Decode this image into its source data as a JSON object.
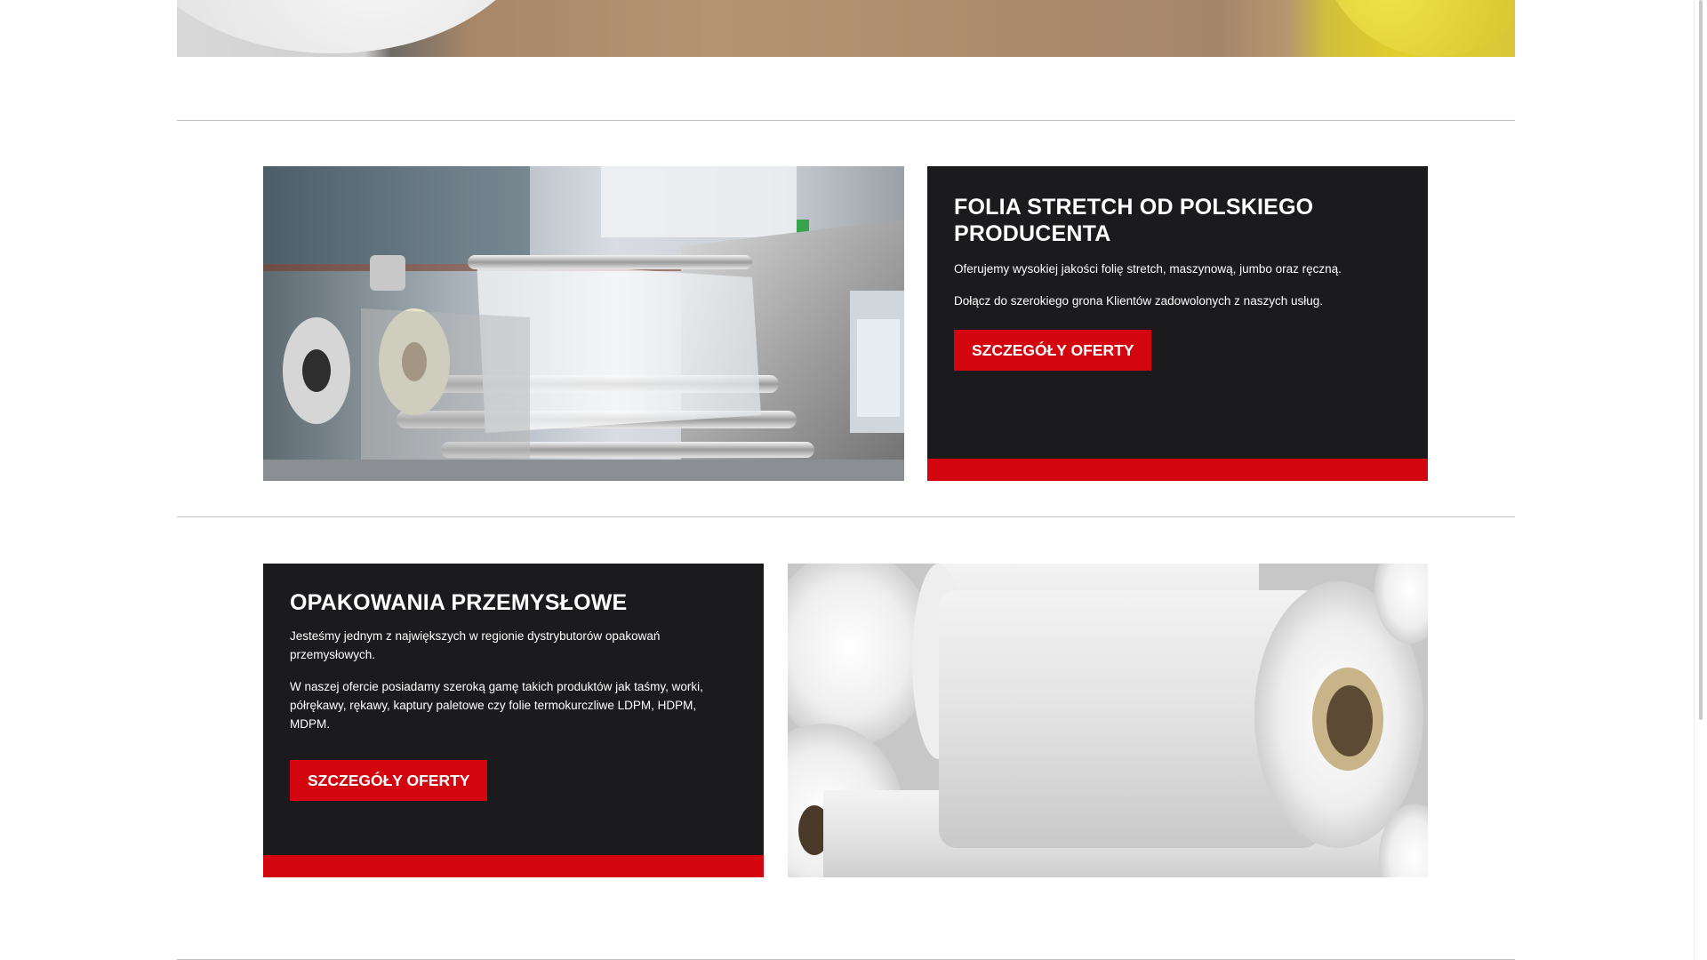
{
  "sections": [
    {
      "heading": "FOLIA STRETCH OD POLSKIEGO PRODUCENTA",
      "paragraphs": [
        "Oferujemy wysokiej jakości folię stretch, maszynową, jumbo oraz ręczną.",
        "Dołącz do szerokiego grona Klientów zadowolonych z naszych usług."
      ],
      "button_label": "SZCZEGÓŁY OFERTY",
      "image": "stretch-film-machine-photo"
    },
    {
      "heading": "OPAKOWANIA PRZEMYSŁOWE",
      "paragraphs": [
        "Jesteśmy jednym z największych w regionie dystrybutorów opakowań przemysłowych.",
        "W naszej ofercie posiadamy szeroką gamę takich produktów jak taśmy, worki, półrękawy, rękawy, kaptury paletowe czy folie termokurczliwe LDPM, HDPM, MDPM."
      ],
      "button_label": "SZCZEGÓŁY OFERTY",
      "image": "plastic-film-rolls-photo"
    }
  ],
  "colors": {
    "card_background": "#1b1b1d",
    "accent_red": "#d3050f",
    "divider": "#bdbdbd"
  }
}
